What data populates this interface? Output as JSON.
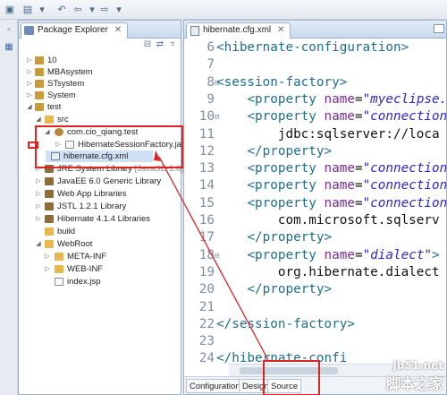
{
  "package_explorer": {
    "tab_label": "Package Explorer",
    "tab_close": "✕",
    "tree": [
      {
        "label": "10",
        "icon": "project-icon"
      },
      {
        "label": "MBAsystem",
        "icon": "project-icon"
      },
      {
        "label": "STsystem",
        "icon": "project-icon"
      },
      {
        "label": "System",
        "icon": "project-icon"
      },
      {
        "label": "test",
        "icon": "project-icon"
      },
      {
        "label": "src",
        "icon": "source-folder-icon"
      },
      {
        "label": "com.cio_qiang.test",
        "icon": "package-icon"
      },
      {
        "label": "HibernateSessionFactory.java",
        "icon": "java-file-icon"
      },
      {
        "label": "hibernate.cfg.xml",
        "icon": "xml-file-icon"
      },
      {
        "label": "JRE System Library",
        "suffix": "[JavaSE-1.6]",
        "icon": "library-icon"
      },
      {
        "label": "JavaEE 6.0 Generic Library",
        "icon": "library-icon"
      },
      {
        "label": "Web App Libraries",
        "icon": "library-icon"
      },
      {
        "label": "JSTL 1.2.1 Library",
        "icon": "library-icon"
      },
      {
        "label": "Hibernate 4.1.4 Libraries",
        "icon": "library-icon"
      },
      {
        "label": "build",
        "icon": "folder-icon"
      },
      {
        "label": "WebRoot",
        "icon": "folder-icon"
      },
      {
        "label": "META-INF",
        "icon": "folder-icon"
      },
      {
        "label": "WEB-INF",
        "icon": "folder-icon"
      },
      {
        "label": "index.jsp",
        "icon": "jsp-file-icon"
      }
    ]
  },
  "editor": {
    "tab_label": "hibernate.cfg.xml",
    "tab_close": "✕",
    "lines": [
      {
        "n": "6",
        "code": "<hibernate-configuration>"
      },
      {
        "n": "7",
        "code": ""
      },
      {
        "n": "8",
        "code": "<session-factory>"
      },
      {
        "n": "9",
        "code": "    <property name=\"myeclipse."
      },
      {
        "n": "10",
        "code": "    <property name=\"connection"
      },
      {
        "n": "11",
        "code": "        jdbc:sqlserver://loca"
      },
      {
        "n": "12",
        "code": "    </property>"
      },
      {
        "n": "13",
        "code": "    <property name=\"connection"
      },
      {
        "n": "14",
        "code": "    <property name=\"connection"
      },
      {
        "n": "15",
        "code": "    <property name=\"connection"
      },
      {
        "n": "16",
        "code": "        com.microsoft.sqlserv"
      },
      {
        "n": "17",
        "code": "    </property>"
      },
      {
        "n": "18",
        "code": "    <property name=\"dialect\">"
      },
      {
        "n": "19",
        "code": "        org.hibernate.dialect"
      },
      {
        "n": "20",
        "code": "    </property>"
      },
      {
        "n": "21",
        "code": ""
      },
      {
        "n": "22",
        "code": "</session-factory>"
      },
      {
        "n": "23",
        "code": ""
      },
      {
        "n": "24",
        "code": "</hibernate-confi"
      }
    ],
    "bottom_tabs": [
      "Configuration",
      "Design",
      "Source"
    ],
    "active_bottom_tab": "Source"
  },
  "watermark": {
    "line1": "jb51.net",
    "line2": "脚本之家"
  },
  "colors": {
    "annotation_red": "#e02424",
    "xml_tag": "#1f6f8b",
    "xml_attr": "#7d2a9a",
    "xml_value": "#2a27d6"
  }
}
